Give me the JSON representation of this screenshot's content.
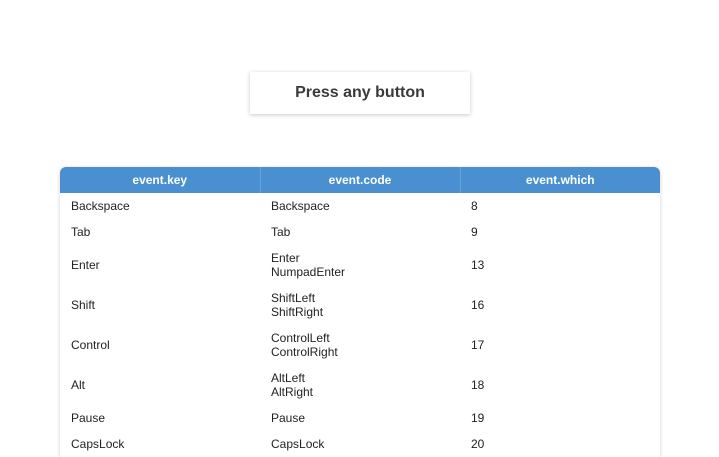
{
  "prompt": {
    "label": "Press any button"
  },
  "table": {
    "headers": [
      "event.key",
      "event.code",
      "event.which"
    ],
    "rows": [
      {
        "key": "Backspace",
        "code": [
          "Backspace"
        ],
        "which": "8"
      },
      {
        "key": "Tab",
        "code": [
          "Tab"
        ],
        "which": "9"
      },
      {
        "key": "Enter",
        "code": [
          "Enter",
          "NumpadEnter"
        ],
        "which": "13"
      },
      {
        "key": "Shift",
        "code": [
          "ShiftLeft",
          "ShiftRight"
        ],
        "which": "16"
      },
      {
        "key": "Control",
        "code": [
          "ControlLeft",
          "ControlRight"
        ],
        "which": "17"
      },
      {
        "key": "Alt",
        "code": [
          "AltLeft",
          "AltRight"
        ],
        "which": "18"
      },
      {
        "key": "Pause",
        "code": [
          "Pause"
        ],
        "which": "19"
      },
      {
        "key": "CapsLock",
        "code": [
          "CapsLock"
        ],
        "which": "20"
      }
    ]
  },
  "colors": {
    "header_bg": "#4a90d0",
    "header_text": "#ffffff"
  }
}
